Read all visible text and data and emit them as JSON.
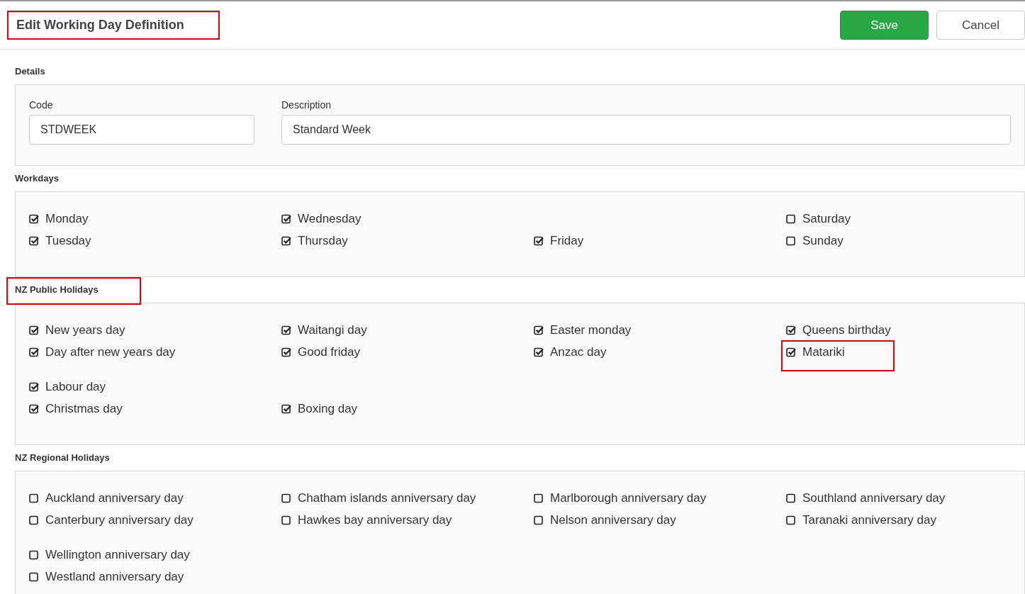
{
  "header": {
    "title": "Edit Working Day Definition",
    "highlighted": true,
    "buttons": [
      {
        "label": "Save",
        "kind": "primary"
      },
      {
        "label": "Cancel",
        "kind": "secondary"
      }
    ]
  },
  "sections": [
    {
      "kind": "fields",
      "title": "Details",
      "highlighted": false,
      "fields": [
        {
          "label": "Code",
          "value": "STDWEEK"
        },
        {
          "label": "Description",
          "value": "Standard Week"
        }
      ]
    },
    {
      "kind": "checks",
      "title": "Workdays",
      "highlighted": false,
      "groups": [
        [
          [
            {
              "kind": "checkbox",
              "label": "Monday",
              "checked": true,
              "highlighted": false
            },
            {
              "kind": "checkbox",
              "label": "Wednesday",
              "checked": true,
              "highlighted": false
            },
            {
              "kind": "blank"
            },
            {
              "kind": "checkbox",
              "label": "Saturday",
              "checked": false,
              "highlighted": false
            }
          ],
          [
            {
              "kind": "checkbox",
              "label": "Tuesday",
              "checked": true,
              "highlighted": false
            },
            {
              "kind": "checkbox",
              "label": "Thursday",
              "checked": true,
              "highlighted": false
            },
            {
              "kind": "checkbox",
              "label": "Friday",
              "checked": true,
              "highlighted": false
            },
            {
              "kind": "checkbox",
              "label": "Sunday",
              "checked": false,
              "highlighted": false
            }
          ]
        ]
      ]
    },
    {
      "kind": "checks",
      "title": "NZ Public Holidays",
      "highlighted": true,
      "groups": [
        [
          [
            {
              "kind": "checkbox",
              "label": "New years day",
              "checked": true,
              "highlighted": false
            },
            {
              "kind": "checkbox",
              "label": "Waitangi day",
              "checked": true,
              "highlighted": false
            },
            {
              "kind": "checkbox",
              "label": "Easter monday",
              "checked": true,
              "highlighted": false
            },
            {
              "kind": "checkbox",
              "label": "Queens birthday",
              "checked": true,
              "highlighted": false
            }
          ],
          [
            {
              "kind": "checkbox",
              "label": "Day after new years day",
              "checked": true,
              "highlighted": false
            },
            {
              "kind": "checkbox",
              "label": "Good friday",
              "checked": true,
              "highlighted": false
            },
            {
              "kind": "checkbox",
              "label": "Anzac day",
              "checked": true,
              "highlighted": false
            },
            {
              "kind": "checkbox",
              "label": "Matariki",
              "checked": true,
              "highlighted": true
            }
          ]
        ],
        [
          [
            {
              "kind": "checkbox",
              "label": "Labour day",
              "checked": true,
              "highlighted": false
            }
          ],
          [
            {
              "kind": "checkbox",
              "label": "Christmas day",
              "checked": true,
              "highlighted": false
            },
            {
              "kind": "checkbox",
              "label": "Boxing day",
              "checked": true,
              "highlighted": false
            }
          ]
        ]
      ]
    },
    {
      "kind": "checks",
      "title": "NZ Regional Holidays",
      "highlighted": false,
      "groups": [
        [
          [
            {
              "kind": "checkbox",
              "label": "Auckland anniversary day",
              "checked": false,
              "highlighted": false
            },
            {
              "kind": "checkbox",
              "label": "Chatham islands anniversary day",
              "checked": false,
              "highlighted": false
            },
            {
              "kind": "checkbox",
              "label": "Marlborough anniversary day",
              "checked": false,
              "highlighted": false
            },
            {
              "kind": "checkbox",
              "label": "Southland anniversary day",
              "checked": false,
              "highlighted": false
            }
          ],
          [
            {
              "kind": "checkbox",
              "label": "Canterbury anniversary day",
              "checked": false,
              "highlighted": false
            },
            {
              "kind": "checkbox",
              "label": "Hawkes bay anniversary day",
              "checked": false,
              "highlighted": false
            },
            {
              "kind": "checkbox",
              "label": "Nelson anniversary day",
              "checked": false,
              "highlighted": false
            },
            {
              "kind": "checkbox",
              "label": "Taranaki anniversary day",
              "checked": false,
              "highlighted": false
            }
          ]
        ],
        [
          [
            {
              "kind": "checkbox",
              "label": "Wellington anniversary day",
              "checked": false,
              "highlighted": false
            }
          ],
          [
            {
              "kind": "checkbox",
              "label": "Westland anniversary day",
              "checked": false,
              "highlighted": false
            }
          ]
        ]
      ]
    }
  ]
}
